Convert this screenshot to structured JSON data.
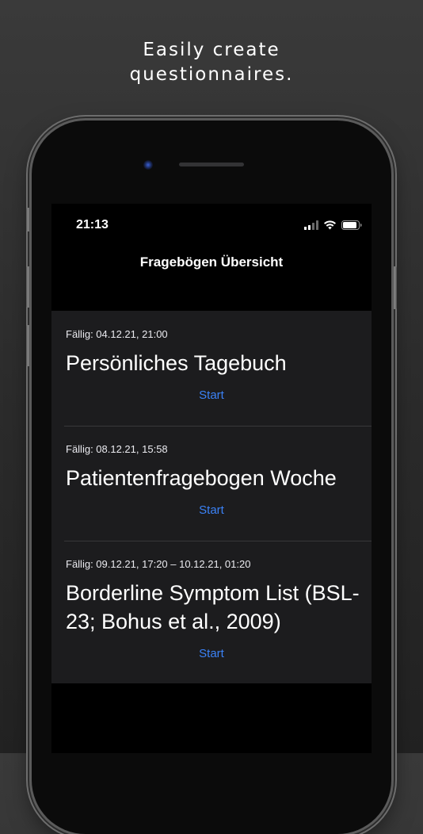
{
  "marketing": {
    "line1": "Easily create",
    "line2": "questionnaires."
  },
  "status_bar": {
    "time": "21:13",
    "icons": [
      "cellular-signal-icon",
      "wifi-icon",
      "battery-icon"
    ]
  },
  "nav": {
    "title": "Fragebögen Übersicht"
  },
  "questionnaires": [
    {
      "due": "Fällig: 04.12.21, 21:00",
      "title": "Persönliches Tagebuch",
      "action": "Start"
    },
    {
      "due": "Fällig: 08.12.21, 15:58",
      "title": "Patientenfragebogen Woche",
      "action": "Start"
    },
    {
      "due": "Fällig: 09.12.21, 17:20 – 10.12.21, 01:20",
      "title": "Borderline Symptom List (BSL-23; Bohus et al., 2009)",
      "action": "Start"
    }
  ],
  "colors": {
    "accent": "#3b82f6",
    "card_background": "#1c1c1e",
    "screen_background": "#000000"
  }
}
